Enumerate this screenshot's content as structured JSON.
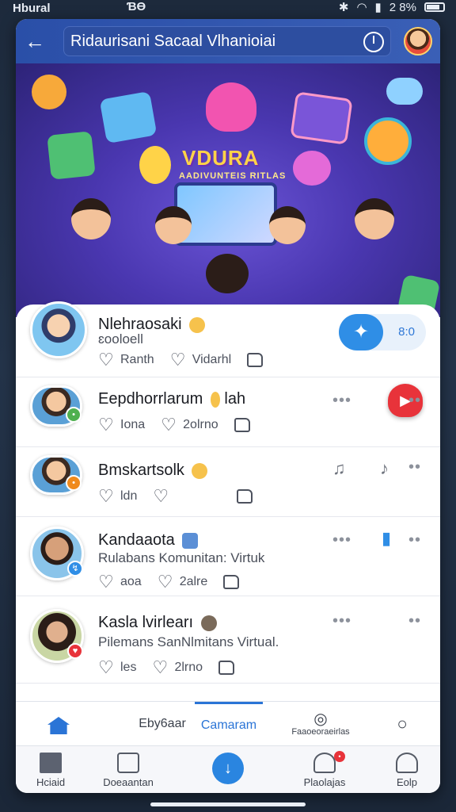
{
  "status_bar": {
    "carrier": "Hbural",
    "time": "ƁƟ",
    "battery": "2 8%"
  },
  "app_bar": {
    "title": "Ridaurisani Sacaal Vlhanioiai"
  },
  "banner": {
    "heading": "VDURA",
    "subheading": "AADIVUNTEIS RITLAS"
  },
  "featured": {
    "name": "Nlehraosaki",
    "sub": "ɛooloell",
    "actions": [
      "Ranth",
      "Vidarhl",
      ""
    ],
    "toggle_value": "8:0"
  },
  "posts": [
    {
      "name": "Eepdhorrlarum",
      "suffix": "lah",
      "sub": "",
      "actions": [
        "Iona",
        "2olrno",
        ""
      ]
    },
    {
      "name": "Bmskartsolk",
      "suffix": "",
      "sub": "",
      "actions": [
        "ldn",
        "",
        ""
      ]
    },
    {
      "name": "Kandaaota",
      "suffix": "",
      "sub": "Rulabans Komunitan: Virtuk",
      "actions": [
        "aoa",
        "2alre",
        ""
      ]
    },
    {
      "name": "Kasla lvirlearı",
      "suffix": "",
      "sub": "Pilemans SanNlmitans Virtual.",
      "actions": [
        "les",
        "2lrno",
        ""
      ]
    }
  ],
  "tabs": {
    "tab2": "Eby6aar",
    "tab3": "Camaram",
    "tab4": "Faaoeoraeirlas"
  },
  "bottom_nav": {
    "item1": "Hciaid",
    "item2": "Doeaantan",
    "item4": "Plaolajas",
    "item5": "Eolp"
  },
  "colors": {
    "primary": "#2a74d6",
    "appbar": "#2a4fa8",
    "alert": "#e8333a"
  }
}
